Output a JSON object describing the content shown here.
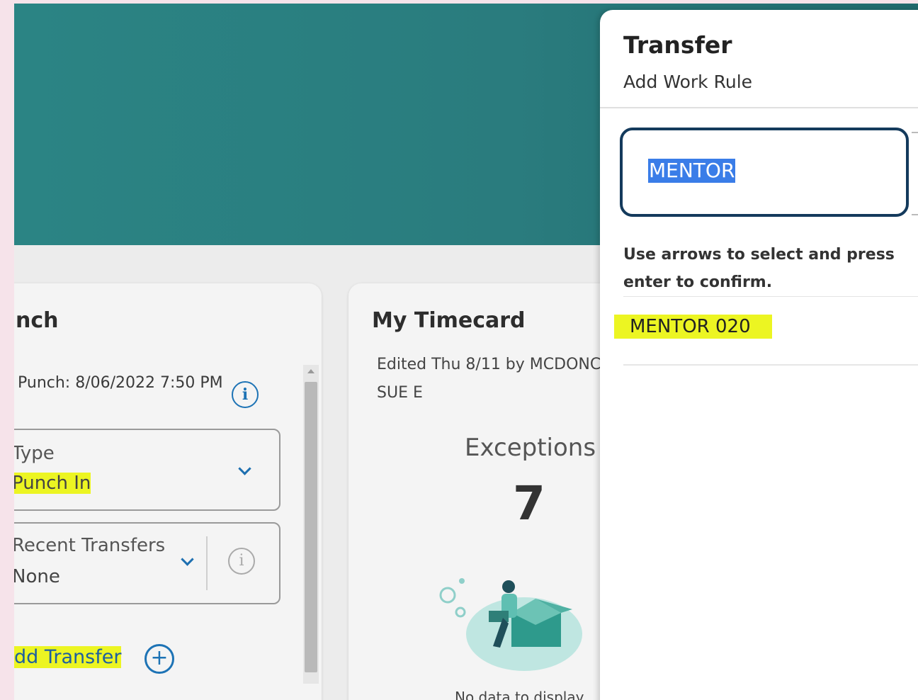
{
  "punch_card": {
    "title": "nch",
    "last_punch": "Punch: 8/06/2022 7:50 PM",
    "type_field": {
      "label": "Type",
      "value": "Punch In"
    },
    "transfers_field": {
      "label": "Recent Transfers",
      "value": "None"
    },
    "add_transfer": "dd Transfer"
  },
  "timecard": {
    "title": "My Timecard",
    "edited_line1": "Edited Thu 8/11 by MCDONC",
    "edited_line2": "SUE E",
    "exceptions_label": "Exceptions",
    "exceptions_value": "7",
    "no_data": "No data to display"
  },
  "transfer_panel": {
    "title": "Transfer",
    "subtitle": "Add Work Rule",
    "search_value": "MENTOR",
    "hint": "Use arrows to select and press enter to confirm.",
    "results": [
      "MENTOR 020"
    ]
  },
  "colors": {
    "banner": "#2a7c7e",
    "highlight": "#ecf522",
    "accent": "#1d73b5",
    "input_border": "#143a5c"
  },
  "icons": [
    "info-icon",
    "chevron-down-icon",
    "add-circle-icon",
    "scroll-up-arrow-icon"
  ]
}
